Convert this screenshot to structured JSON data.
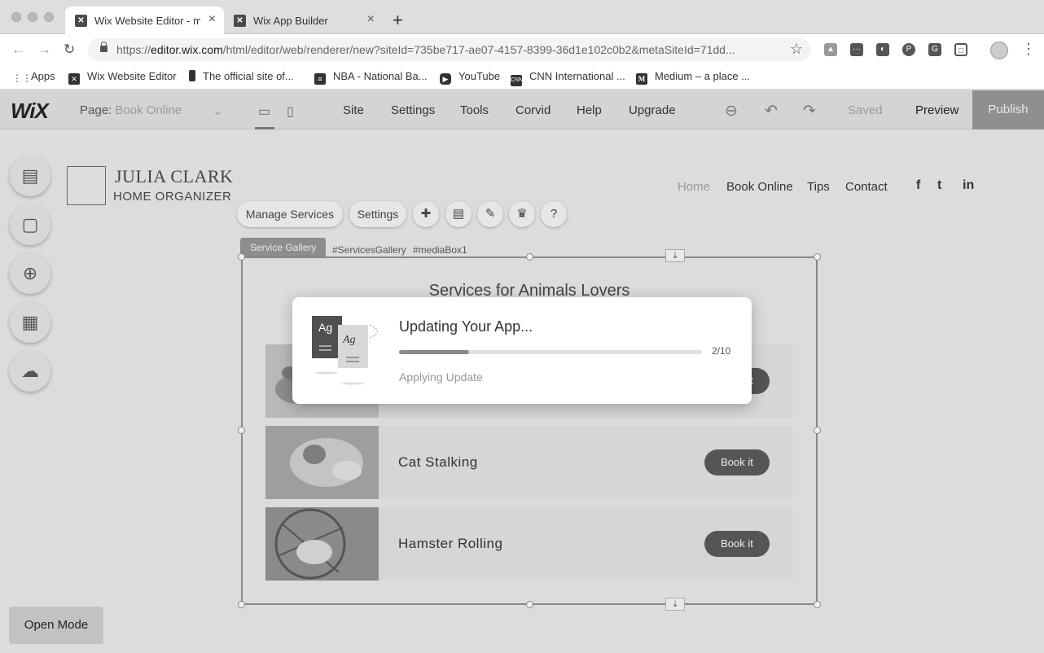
{
  "browser": {
    "tabs": [
      {
        "title": "Wix Website Editor - m",
        "favicon": "wix-icon"
      },
      {
        "title": "Wix App Builder",
        "favicon": "wix-icon"
      }
    ],
    "new_tab": "+",
    "close_glyph": "×",
    "url_host": "editor.wix.com",
    "url_prefix": "https://",
    "url_path": "/html/editor/web/renderer/new?siteId=735be717-ae07-4157-8399-36d1e102c0b2&metaSiteId=71dd...",
    "bookmarks": [
      {
        "label": "Apps",
        "icon": "apps-grid-icon"
      },
      {
        "label": "Wix Website Editor",
        "icon": "wix-icon"
      },
      {
        "label": "The official site of...",
        "icon": "site-icon"
      },
      {
        "label": "NBA - National Ba...",
        "icon": "nba-icon"
      },
      {
        "label": "YouTube",
        "icon": "youtube-icon"
      },
      {
        "label": "CNN International ...",
        "icon": "cnn-icon"
      },
      {
        "label": "Medium – a place ...",
        "icon": "medium-icon"
      }
    ]
  },
  "editor": {
    "logo": "WiX",
    "page_label": "Page:",
    "page_name": "Book Online",
    "menu": [
      "Site",
      "Settings",
      "Tools",
      "Corvid",
      "Help",
      "Upgrade"
    ],
    "saved": "Saved",
    "preview": "Preview",
    "publish": "Publish",
    "open_mode": "Open Mode"
  },
  "site": {
    "brand_name": "JULIA CLARK",
    "brand_sub": "HOME ORGANIZER",
    "nav": [
      "Home",
      "Book Online",
      "Tips",
      "Contact"
    ],
    "social": [
      "f",
      "t",
      "in"
    ]
  },
  "component": {
    "manage_services": "Manage Services",
    "settings": "Settings",
    "label": "Service Gallery",
    "ids": [
      "#ServicesGallery",
      "#mediaBox1"
    ]
  },
  "gallery": {
    "title": "Services for Animals Lovers",
    "book_label": "Book it",
    "services": [
      {
        "name": ""
      },
      {
        "name": "Cat Stalking"
      },
      {
        "name": "Hamster Rolling"
      }
    ]
  },
  "modal": {
    "title": "Updating Your App...",
    "progress": 0.23,
    "count": "2/10",
    "status": "Applying Update",
    "icon_text": "Ag"
  },
  "colors": {
    "publish_bg": "#8f8f8f",
    "progress_fill": "#8a8a8a",
    "dim_overlay": "#dcdcdc"
  }
}
